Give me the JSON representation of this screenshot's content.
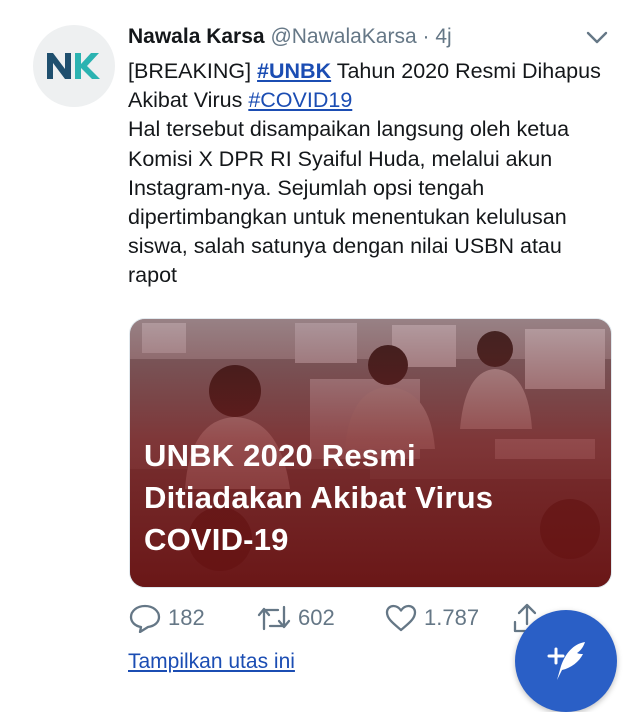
{
  "tweet": {
    "author_name": "Nawala Karsa",
    "author_handle": "@NawalaKarsa",
    "separator": "·",
    "time": "4j",
    "avatar_text": "NK",
    "text": {
      "prefix": "[BREAKING] ",
      "hashtag1": "#UNBK",
      "middle": " Tahun 2020 Resmi Dihapus Akibat Virus ",
      "hashtag2": "#COVID19",
      "body": "Hal tersebut disampaikan langsung oleh ketua Komisi X DPR RI Syaiful Huda, melalui akun Instagram-nya. Sejumlah opsi tengah dipertimbangkan untuk menentukan kelulusan siswa, salah satunya dengan nilai USBN atau rapot"
    },
    "media": {
      "headline_line1": "UNBK 2020 Resmi",
      "headline_line2": "Ditiadakan Akibat Virus",
      "headline_line3": "COVID-19"
    },
    "actions": {
      "replies": "182",
      "retweets": "602",
      "likes": "1.787"
    },
    "show_thread": "Tampilkan utas ini"
  },
  "icons": {
    "reply": "reply-icon",
    "retweet": "retweet-icon",
    "like": "heart-icon",
    "share": "share-icon",
    "chevron": "chevron-down-icon",
    "compose": "compose-tweet-icon"
  },
  "colors": {
    "link": "#1b4db3",
    "muted": "#657786",
    "fab": "#2a5fc6",
    "media_overlay": "#7a1a1a"
  }
}
